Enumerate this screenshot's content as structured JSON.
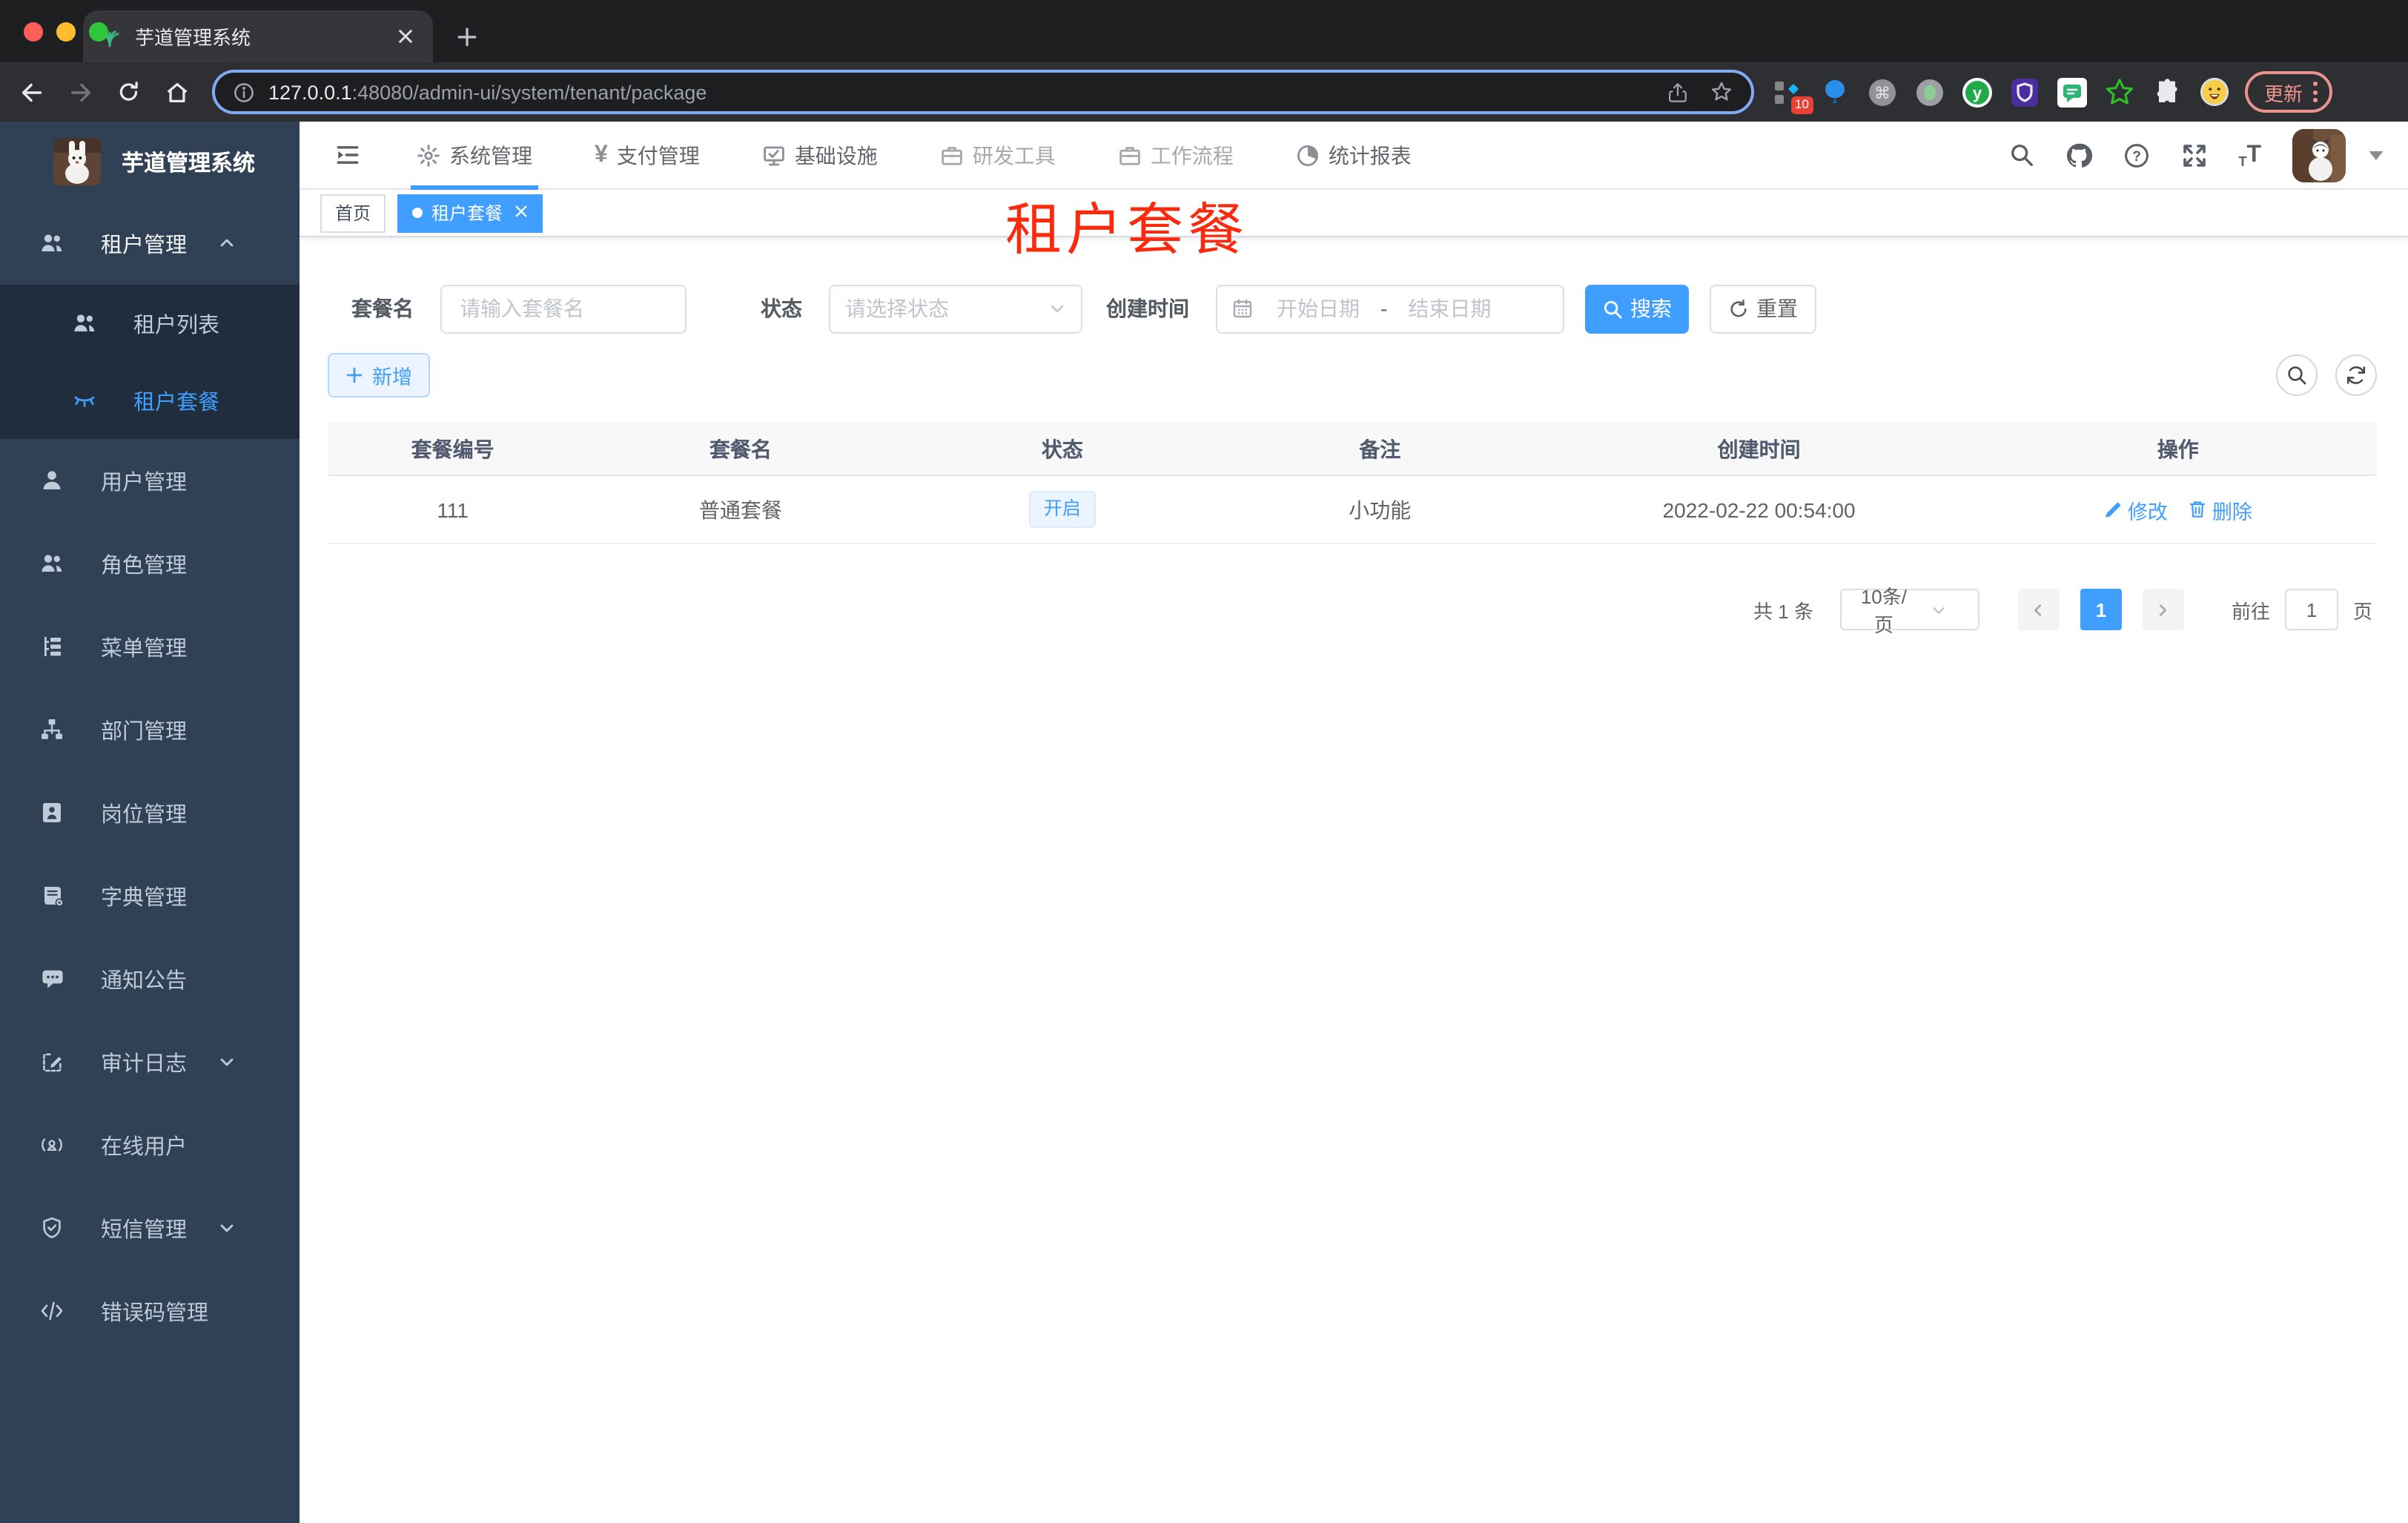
{
  "browser": {
    "tab_title": "芋道管理系统",
    "url": {
      "host": "127.0.0.1",
      "rest": ":48080/admin-ui/system/tenant/package"
    },
    "extensions": {
      "badge": "10",
      "update_label": "更新"
    },
    "glyphs": {
      "command": "⌘",
      "y": "y",
      "plus": "+",
      "close": "✕"
    }
  },
  "app": {
    "logo_title": "芋道管理系统",
    "nav": [
      {
        "label": "系统管理"
      },
      {
        "label": "支付管理"
      },
      {
        "label": "基础设施"
      },
      {
        "label": "研发工具"
      },
      {
        "label": "工作流程"
      },
      {
        "label": "统计报表"
      }
    ],
    "glyphs": {
      "yen": "¥",
      "question": "?",
      "font_small": "T",
      "font_big": "T",
      "code": "</>"
    },
    "sidebar": [
      {
        "label": "租户管理"
      },
      {
        "label": "租户列表"
      },
      {
        "label": "租户套餐"
      },
      {
        "label": "用户管理"
      },
      {
        "label": "角色管理"
      },
      {
        "label": "菜单管理"
      },
      {
        "label": "部门管理"
      },
      {
        "label": "岗位管理"
      },
      {
        "label": "字典管理"
      },
      {
        "label": "通知公告"
      },
      {
        "label": "审计日志"
      },
      {
        "label": "在线用户"
      },
      {
        "label": "短信管理"
      },
      {
        "label": "错误码管理"
      }
    ],
    "tags": [
      {
        "label": "首页"
      },
      {
        "label": "租户套餐"
      }
    ],
    "overlay_title": "租户套餐",
    "form": {
      "name_label": "套餐名",
      "name_placeholder": "请输入套餐名",
      "status_label": "状态",
      "status_placeholder": "请选择状态",
      "date_label": "创建时间",
      "date_start": "开始日期",
      "date_sep": "-",
      "date_end": "结束日期",
      "search_label": "搜索",
      "reset_label": "重置",
      "add_label": "新增"
    },
    "table": {
      "columns": [
        "套餐编号",
        "套餐名",
        "状态",
        "备注",
        "创建时间",
        "操作"
      ],
      "rows": [
        {
          "id": "111",
          "name": "普通套餐",
          "status": "开启",
          "remark": "小功能",
          "created": "2022-02-22 00:54:00",
          "edit": "修改",
          "delete": "删除"
        }
      ]
    },
    "pagination": {
      "total": "共 1 条",
      "size": "10条/页",
      "page": "1",
      "go_label": "前往",
      "go_value": "1",
      "unit": "页"
    }
  }
}
